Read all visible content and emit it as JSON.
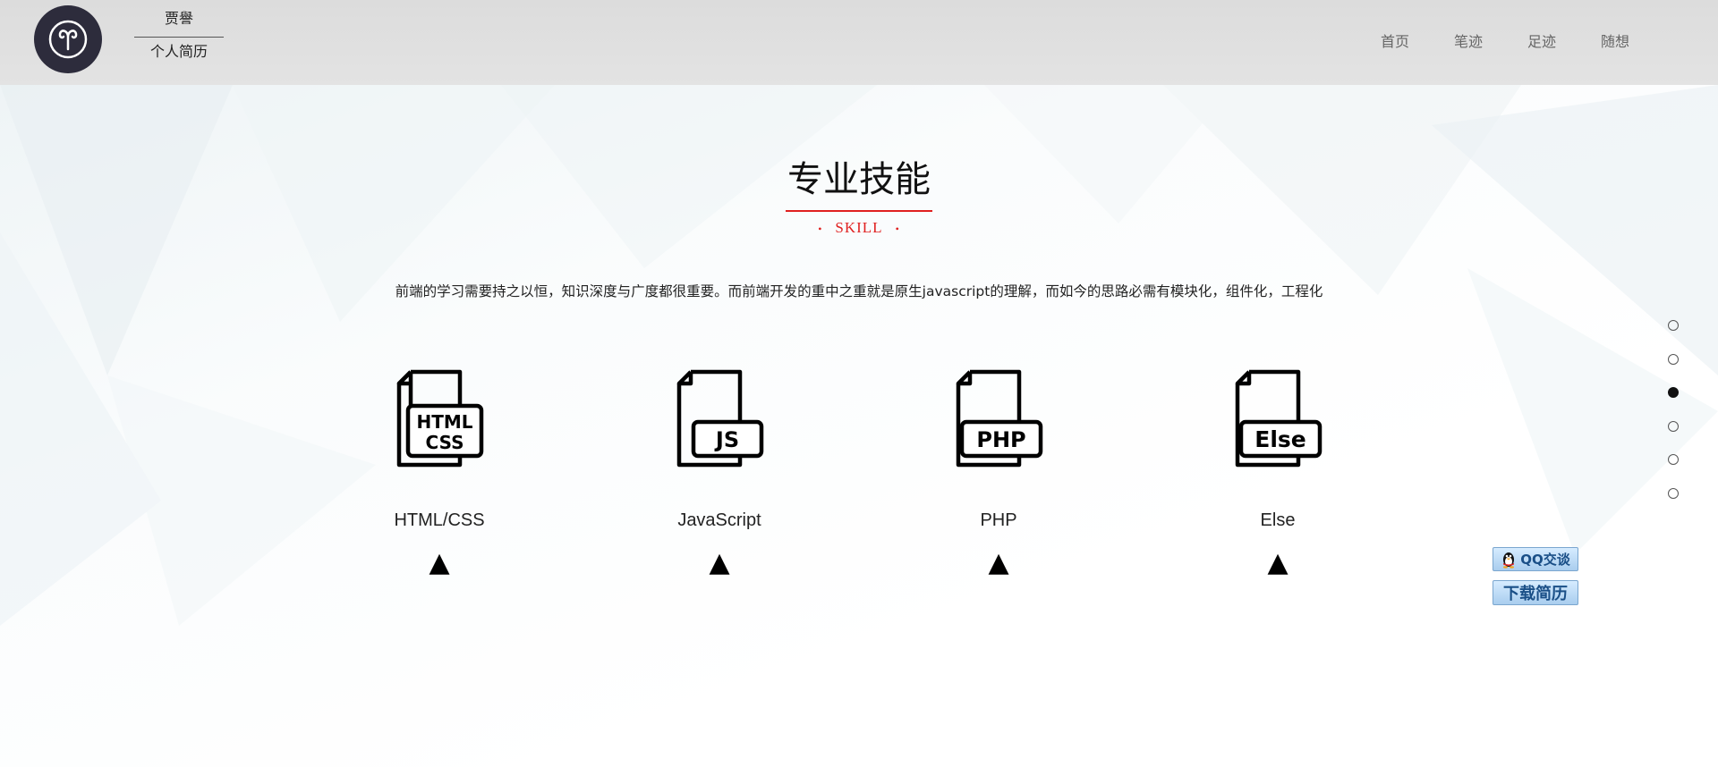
{
  "header": {
    "brand_name": "贾譽",
    "brand_subtitle": "个人简历",
    "nav": [
      {
        "label": "首页"
      },
      {
        "label": "笔迹"
      },
      {
        "label": "足迹"
      },
      {
        "label": "随想"
      }
    ]
  },
  "section": {
    "title": "专业技能",
    "subtitle": "SKILL",
    "description": "前端的学习需要持之以恒，知识深度与广度都很重要。而前端开发的重中之重就是原生javascript的理解，而如今的思路必需有模块化，组件化，工程化"
  },
  "skills": [
    {
      "label": "HTML/CSS",
      "icon": "html-css-file-icon",
      "icon_text_line1": "HTML",
      "icon_text_line2": "CSS",
      "arrow": "▲"
    },
    {
      "label": "JavaScript",
      "icon": "js-file-icon",
      "icon_text_line1": "JS",
      "arrow": "▲"
    },
    {
      "label": "PHP",
      "icon": "php-file-icon",
      "icon_text_line1": "PHP",
      "arrow": "▲"
    },
    {
      "label": "Else",
      "icon": "else-file-icon",
      "icon_text_line1": "Else",
      "arrow": "▲"
    }
  ],
  "pager": {
    "count": 6,
    "active_index": 2
  },
  "floating": {
    "qq_label": "QQ交谈",
    "download_label": "下载简历"
  },
  "colors": {
    "accent_red": "#e02020",
    "logo_bg": "#2d2c3c",
    "header_bg": "#dcdcdc"
  }
}
